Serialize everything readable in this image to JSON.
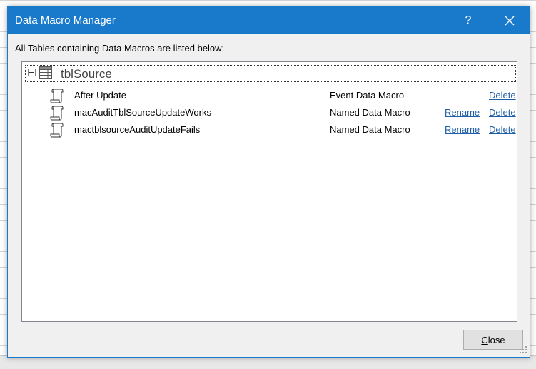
{
  "window": {
    "title": "Data Macro Manager",
    "help_label": "?"
  },
  "description": "All Tables containing Data Macros are listed below:",
  "tables": [
    {
      "name": "tblSource",
      "macros": [
        {
          "name": "After Update",
          "type": "Event Data Macro",
          "rename": "",
          "delete": "Delete"
        },
        {
          "name": "macAuditTblSourceUpdateWorks",
          "type": "Named Data Macro",
          "rename": "Rename",
          "delete": "Delete"
        },
        {
          "name": "mactblsourceAuditUpdateFails",
          "type": "Named Data Macro",
          "rename": "Rename",
          "delete": "Delete"
        }
      ]
    }
  ],
  "buttons": {
    "close_label": "Close"
  },
  "colors": {
    "titlebar": "#1979ca",
    "link": "#1f5ea8"
  },
  "icons": {
    "expander": "collapse-minus-icon",
    "table": "table-icon",
    "macro": "scroll-macro-icon",
    "close": "close-x-icon"
  }
}
